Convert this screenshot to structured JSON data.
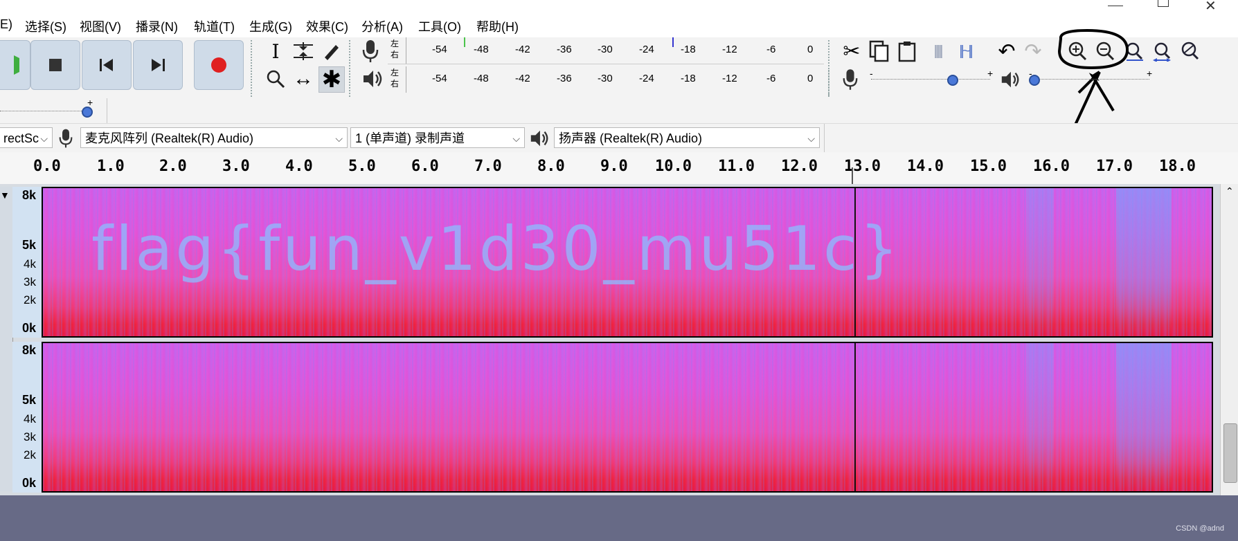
{
  "window": {
    "controls": [
      "minimize",
      "restore",
      "close"
    ]
  },
  "menubar": {
    "items": [
      {
        "label": "E)"
      },
      {
        "label": "选择(S)"
      },
      {
        "label": "视图(V)"
      },
      {
        "label": "播录(N)"
      },
      {
        "label": "轨道(T)"
      },
      {
        "label": "生成(G)"
      },
      {
        "label": "效果(C)"
      },
      {
        "label": "分析(A)"
      },
      {
        "label": "工具(O)"
      },
      {
        "label": "帮助(H)"
      }
    ]
  },
  "meters": {
    "ticks": [
      "-54",
      "-48",
      "-42",
      "-36",
      "-30",
      "-24",
      "-18",
      "-12",
      "-6",
      "0"
    ],
    "left": "左",
    "right": "右"
  },
  "sliders": {
    "minus": "-",
    "plus": "+"
  },
  "devices": {
    "host": "rectSc",
    "input_device": "麦克风阵列 (Realtek(R) Audio)",
    "channels": "1 (单声道) 录制声道",
    "output_device": "扬声器 (Realtek(R) Audio)"
  },
  "ruler": {
    "labels": [
      "0.0",
      "1.0",
      "2.0",
      "3.0",
      "4.0",
      "5.0",
      "6.0",
      "7.0",
      "8.0",
      "9.0",
      "10.0",
      "11.0",
      "12.0",
      "13.0",
      "14.0",
      "15.0",
      "16.0",
      "17.0",
      "18.0"
    ]
  },
  "tracks": [
    {
      "scale": [
        "8k",
        "5k",
        "4k",
        "3k",
        "2k",
        "0k"
      ],
      "hidden_text": "flag{fun_v1d30_mu51c}"
    },
    {
      "scale": [
        "8k",
        "5k",
        "4k",
        "3k",
        "2k",
        "0k"
      ]
    }
  ],
  "watermark": "CSDN @adnd",
  "colors": {
    "spectrogram_red": "#f0223a",
    "spectrogram_magenta": "#d45ee8",
    "spectrogram_blue": "#7aa6ff",
    "toolbar_button": "#cfdbe8",
    "play_green": "#3fae3f",
    "record_red": "#e02020",
    "background_bottom": "#676a86"
  }
}
